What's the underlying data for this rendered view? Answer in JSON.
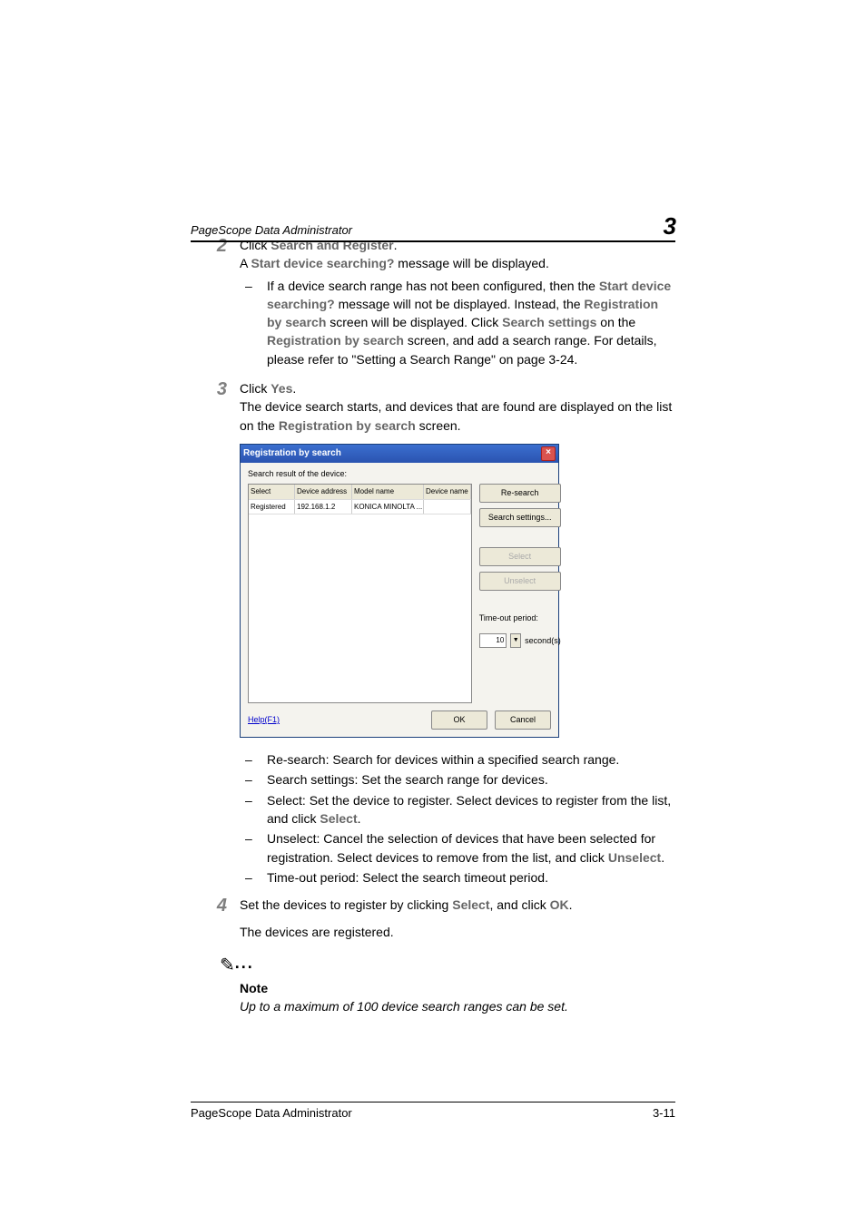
{
  "header": {
    "title": "PageScope Data Administrator",
    "chapter": "3"
  },
  "steps": {
    "s2": {
      "num": "2",
      "l1a": "Click ",
      "l1b": "Search and Register",
      "l1c": ".",
      "l2a": "A ",
      "l2b": "Start device searching?",
      "l2c": " message will be displayed.",
      "b1a": "If a device search range has not been configured, then the ",
      "b1b": "Start device searching?",
      "b1c": " message will not be displayed. Instead, the ",
      "b1d": "Registration by search",
      "b1e": " screen will be displayed. Click ",
      "b1f": "Search settings",
      "b1g": " on the ",
      "b1h": "Registration by search",
      "b1i": " screen, and add a search range. For details, please refer to \"Setting a Search Range\" on page 3-24."
    },
    "s3": {
      "num": "3",
      "l1a": "Click ",
      "l1b": "Yes",
      "l1c": ".",
      "l2a": "The device search starts, and devices that are found are displayed on the list on the ",
      "l2b": "Registration by search",
      "l2c": " screen.",
      "items": {
        "i1": "Re-search: Search for devices within a specified search range.",
        "i2": "Search settings: Set the search range for devices.",
        "i3a": "Select: Set the device to register. Select devices to register from the list, and click ",
        "i3b": "Select",
        "i3c": ".",
        "i4a": "Unselect: Cancel the selection of devices that have been selected for registration. Select devices to remove from the list, and click ",
        "i4b": "Unselect",
        "i4c": ".",
        "i5": "Time-out period: Select the search timeout period."
      }
    },
    "s4": {
      "num": "4",
      "l1a": "Set the devices to register by clicking ",
      "l1b": "Select",
      "l1c": ", and click ",
      "l1d": "OK",
      "l1e": ".",
      "l2": "The devices are registered."
    }
  },
  "dialog": {
    "title": "Registration by search",
    "label": "Search result of the device:",
    "cols": {
      "c1": "Select",
      "c2": "Device address",
      "c3": "Model name",
      "c4": "Device name"
    },
    "row": {
      "c1": "Registered",
      "c2": "192.168.1.2",
      "c3": "KONICA MINOLTA ...",
      "c4": ""
    },
    "btns": {
      "research": "Re-search",
      "settings": "Search settings...",
      "select": "Select",
      "unselect": "Unselect"
    },
    "timeout_label": "Time-out period:",
    "timeout_value": "10",
    "timeout_unit": "second(s)",
    "help": "Help(F1)",
    "ok": "OK",
    "cancel": "Cancel"
  },
  "note": {
    "title": "Note",
    "text": "Up to a maximum of 100 device search ranges can be set."
  },
  "footer": {
    "left": "PageScope Data Administrator",
    "right": "3-11"
  }
}
